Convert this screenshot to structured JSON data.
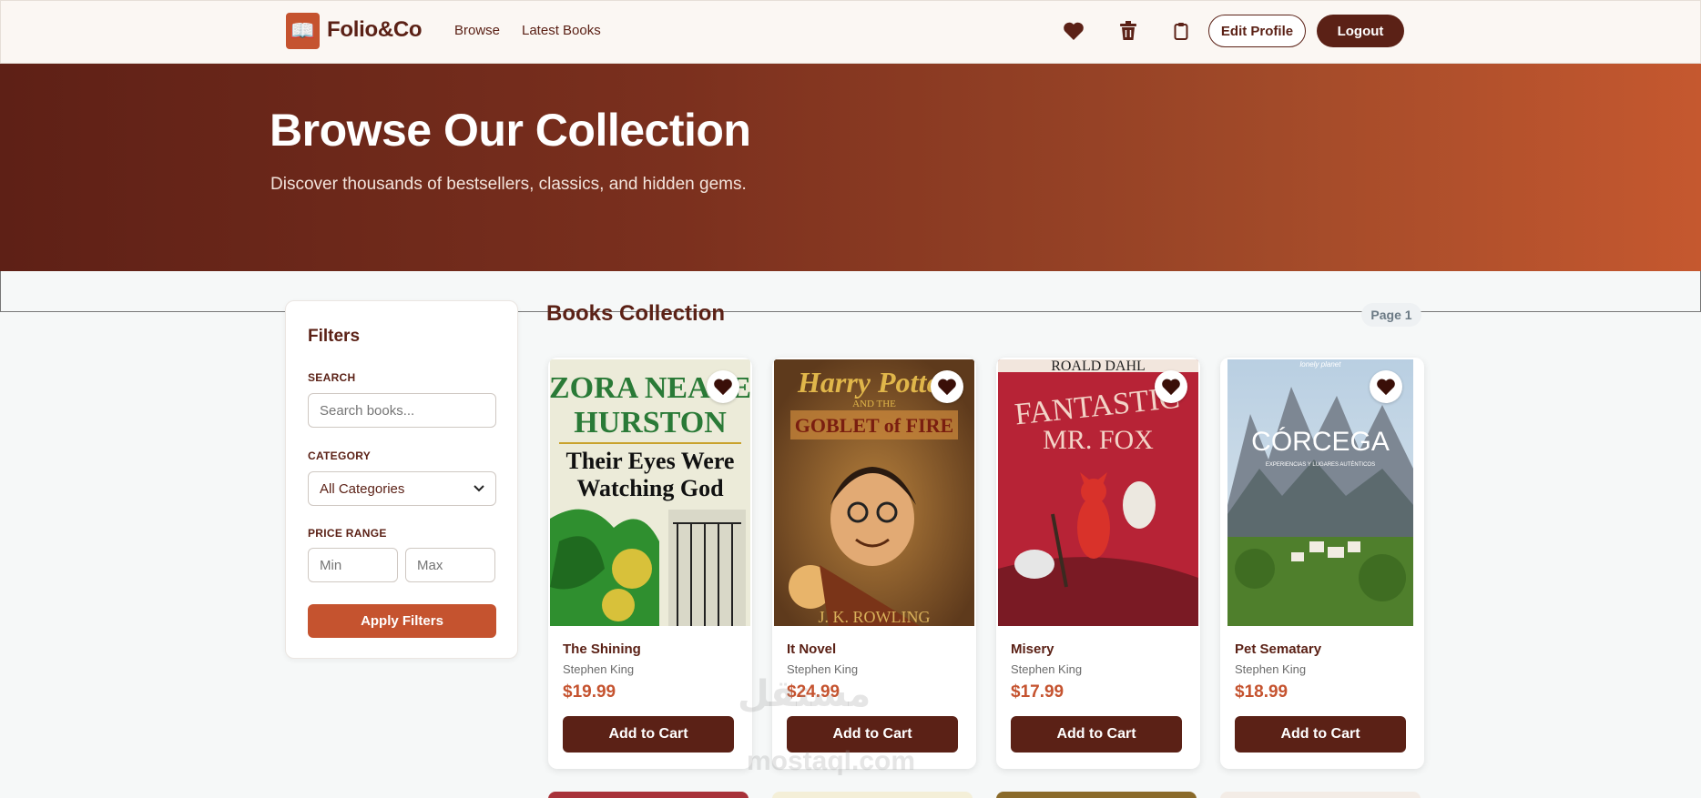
{
  "nav": {
    "logo_glyph": "📖",
    "brand": "Folio&Co",
    "links": [
      "Browse",
      "Latest Books"
    ],
    "icons": [
      "heart-icon",
      "trash-icon",
      "clipboard-icon"
    ],
    "edit_profile": "Edit Profile",
    "logout": "Logout"
  },
  "hero": {
    "title": "Browse Our Collection",
    "subtitle": "Discover thousands of bestsellers, classics, and hidden gems."
  },
  "filters": {
    "title": "Filters",
    "search_label": "SEARCH",
    "search_placeholder": "Search books...",
    "category_label": "CATEGORY",
    "category_value": "All Categories",
    "price_label": "PRICE RANGE",
    "min_placeholder": "Min",
    "max_placeholder": "Max",
    "apply": "Apply Filters"
  },
  "collection": {
    "title": "Books Collection",
    "page": "Page 1",
    "books": [
      {
        "title": "The Shining",
        "author": "Stephen King",
        "price": "$19.99",
        "cta": "Add to Cart",
        "cover_text": [
          "ZORA NEALE",
          "HURSTON",
          "Their Eyes Were",
          "Watching God"
        ]
      },
      {
        "title": "It Novel",
        "author": "Stephen King",
        "price": "$24.99",
        "cta": "Add to Cart",
        "cover_text": [
          "Harry Potter",
          "AND THE",
          "GOBLET of FIRE",
          "J. K. ROWLING"
        ]
      },
      {
        "title": "Misery",
        "author": "Stephen King",
        "price": "$17.99",
        "cta": "Add to Cart",
        "cover_text": [
          "ROALD DAHL",
          "FANTASTIC",
          "MR. FOX"
        ]
      },
      {
        "title": "Pet Sematary",
        "author": "Stephen King",
        "price": "$18.99",
        "cta": "Add to Cart",
        "cover_text": [
          "lonely planet",
          "CÓRCEGA",
          "EXPERIENCIAS Y LUGARES AUTÉNTICOS"
        ]
      }
    ]
  },
  "watermark": {
    "arabic": "مستقل",
    "latin": "mostaql.com"
  },
  "colors": {
    "brand_dark": "#5b2116",
    "accent": "#c5532f",
    "nav_bg": "#fbf7f3"
  }
}
